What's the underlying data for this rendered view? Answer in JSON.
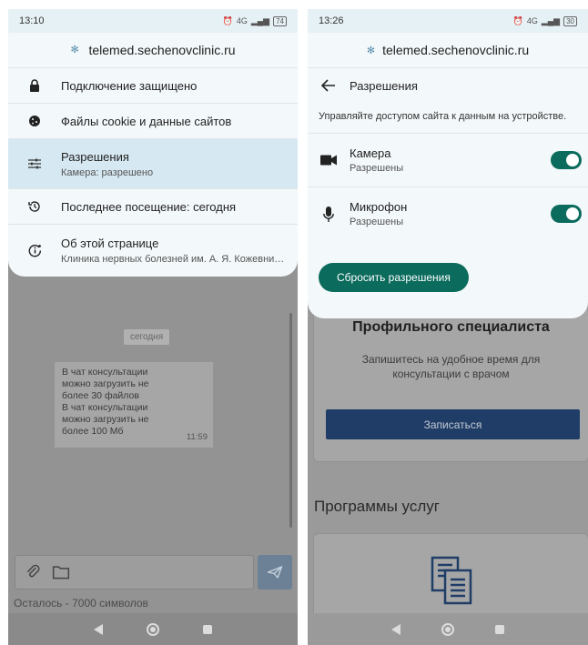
{
  "left": {
    "status": {
      "time": "13:10",
      "network": "4G",
      "battery": "74"
    },
    "url": "telemed.sechenovclinic.ru",
    "menu": [
      {
        "title": "Подключение защищено",
        "subtitle": ""
      },
      {
        "title": "Файлы cookie и данные сайтов",
        "subtitle": ""
      },
      {
        "title": "Разрешения",
        "subtitle": "Камера: разрешено"
      },
      {
        "title": "Последнее посещение: сегодня",
        "subtitle": ""
      },
      {
        "title": "Об этой странице",
        "subtitle": "Клиника нервных болезней им. А. Я. Кожевникова"
      }
    ],
    "chat": {
      "date_chip": "сегодня",
      "message_lines": [
        "В чат консультации",
        "можно загрузить не",
        "более 30 файлов",
        "В чат консультации",
        "можно загрузить не",
        "более 100 Мб"
      ],
      "message_time": "11:59",
      "chars_left": "Осталось - 7000 символов"
    }
  },
  "right": {
    "status": {
      "time": "13:26",
      "network": "4G",
      "battery": "30"
    },
    "url": "telemed.sechenovclinic.ru",
    "title": "Разрешения",
    "description": "Управляйте доступом сайта к данным на устройстве.",
    "permissions": [
      {
        "name": "Камера",
        "state": "Разрешены",
        "enabled": true
      },
      {
        "name": "Микрофон",
        "state": "Разрешены",
        "enabled": true
      }
    ],
    "reset_label": "Сбросить разрешения",
    "page": {
      "card_title": "Профильного специалиста",
      "card_desc": "Запишитесь на удобное время для консультации с врачом",
      "card_button": "Записаться",
      "section_title": "Программы услуг"
    }
  },
  "colors": {
    "accent": "#0b6b5d",
    "sheet": "#f3f8fa",
    "active_row": "#d6e8f1",
    "page_button": "#1f3d67"
  }
}
